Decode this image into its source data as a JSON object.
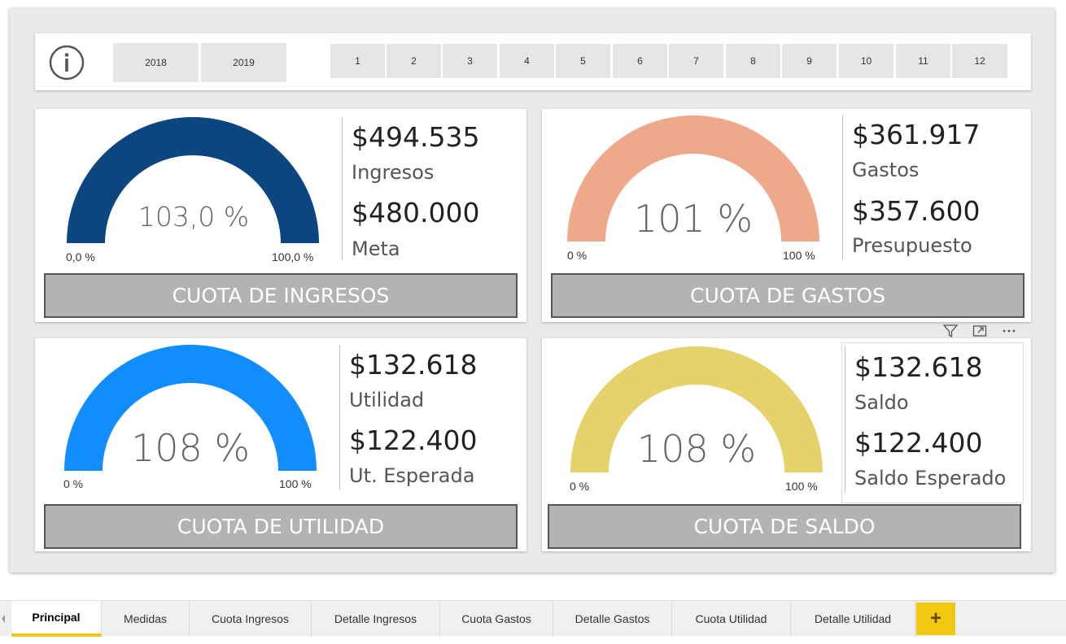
{
  "colors": {
    "ingresos": "#0b4680",
    "gastos": "#f0a88a",
    "utilidad": "#118dff",
    "saldo": "#e6d26a",
    "card_button": "#b3b3b3",
    "tab_accent": "#f2c811"
  },
  "filters": {
    "info_icon": "info-icon",
    "years": [
      "2018",
      "2019"
    ],
    "months": [
      "1",
      "2",
      "3",
      "4",
      "5",
      "6",
      "7",
      "8",
      "9",
      "10",
      "11",
      "12"
    ]
  },
  "cards": {
    "ingresos": {
      "percent": "103,0 %",
      "fraction": 1.0,
      "min": "0,0 %",
      "max": "100,0 %",
      "value1": "$494.535",
      "label1": "Ingresos",
      "value2": "$480.000",
      "label2": "Meta",
      "button": "CUOTA DE INGRESOS"
    },
    "gastos": {
      "percent": "101 %",
      "fraction": 1.0,
      "min": "0 %",
      "max": "100 %",
      "value1": "$361.917",
      "label1": "Gastos",
      "value2": "$357.600",
      "label2": "Presupuesto",
      "button": "CUOTA DE GASTOS"
    },
    "utilidad": {
      "percent": "108 %",
      "fraction": 1.0,
      "min": "0 %",
      "max": "100 %",
      "value1": "$132.618",
      "label1": "Utilidad",
      "value2": "$122.400",
      "label2": "Ut. Esperada",
      "button": "CUOTA DE UTILIDAD"
    },
    "saldo": {
      "percent": "108 %",
      "fraction": 1.0,
      "min": "0 %",
      "max": "100 %",
      "value1": "$132.618",
      "label1": "Saldo",
      "value2": "$122.400",
      "label2": "Saldo Esperado",
      "button": "CUOTA DE SALDO"
    }
  },
  "visual_header_icons": [
    "filter-icon",
    "focus-mode-icon",
    "more-options-icon"
  ],
  "tabs": [
    {
      "label": "Principal",
      "active": true
    },
    {
      "label": "Medidas"
    },
    {
      "label": "Cuota Ingresos"
    },
    {
      "label": "Detalle Ingresos"
    },
    {
      "label": "Cuota Gastos"
    },
    {
      "label": "Detalle Gastos"
    },
    {
      "label": "Cuota Utilidad"
    },
    {
      "label": "Detalle Utilidad"
    }
  ],
  "add_tab_label": "+"
}
